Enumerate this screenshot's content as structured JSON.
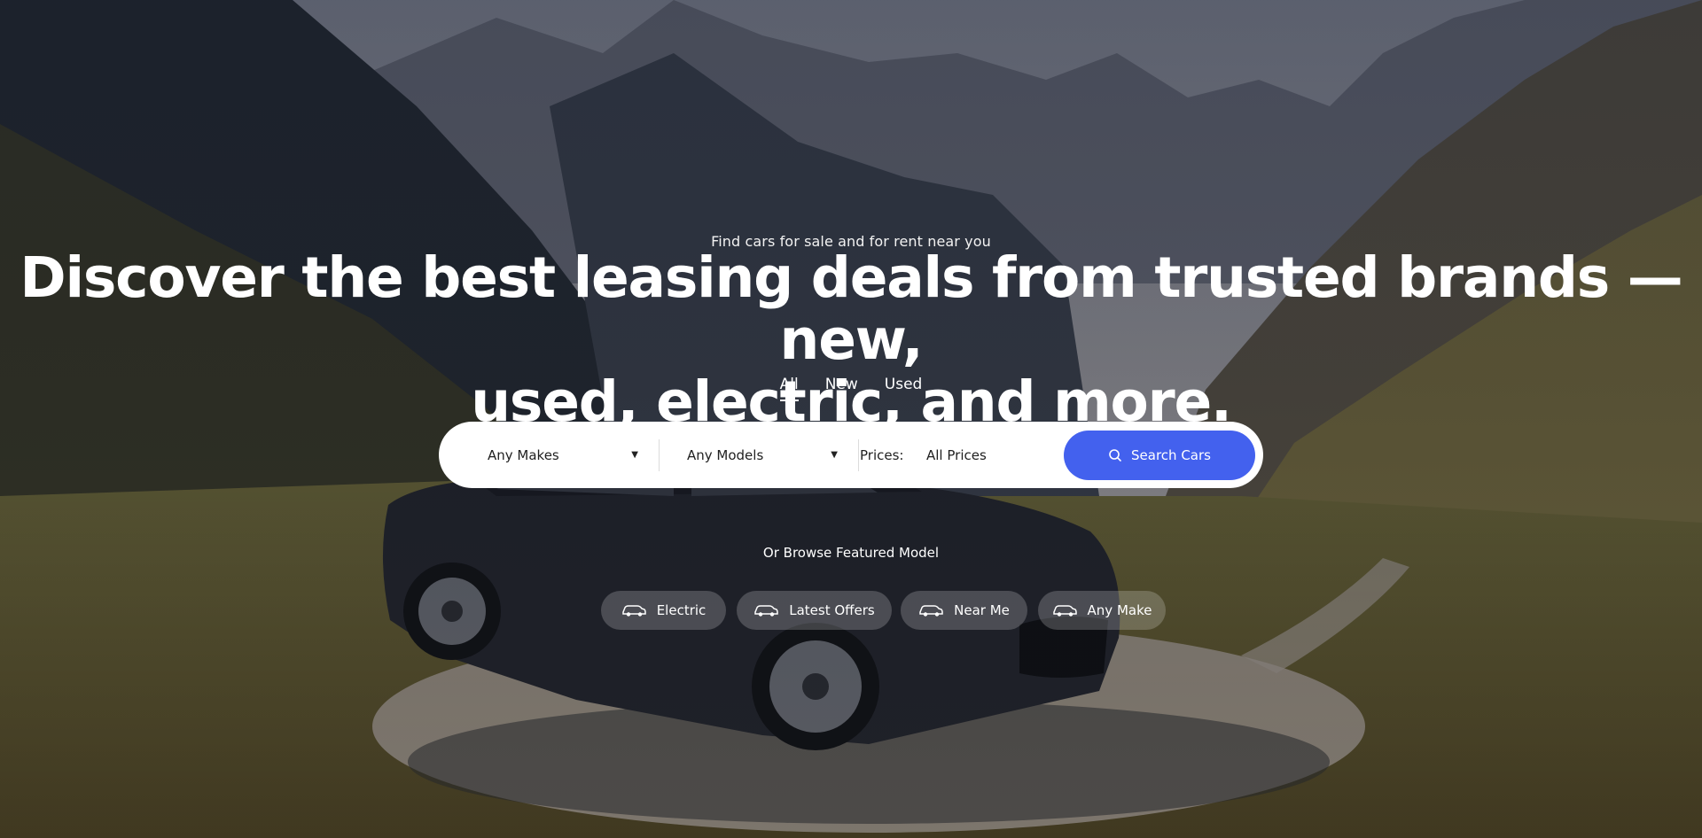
{
  "hero": {
    "tagline": "Find cars for sale and for rent near you",
    "headline_line1": "Discover the best leasing deals from trusted brands — new,",
    "headline_line2": "used, electric, and more."
  },
  "tabs": [
    {
      "label": "All",
      "active": true
    },
    {
      "label": "New",
      "active": false
    },
    {
      "label": "Used",
      "active": false
    }
  ],
  "search": {
    "make_value": "Any Makes",
    "model_value": "Any Models",
    "prices_label": "Prices:",
    "prices_value": "All Prices",
    "button_label": "Search Cars",
    "button_icon": "search-icon"
  },
  "featured": {
    "heading": "Or Browse Featured Model",
    "items": [
      {
        "label": "Electric",
        "icon": "car-icon"
      },
      {
        "label": "Latest Offers",
        "icon": "car-icon"
      },
      {
        "label": "Near Me",
        "icon": "car-icon"
      },
      {
        "label": "Any Make",
        "icon": "car-icon"
      }
    ]
  },
  "colors": {
    "accent": "#4361ee",
    "text_on_hero": "#ffffff",
    "search_bar_bg": "#ffffff"
  }
}
